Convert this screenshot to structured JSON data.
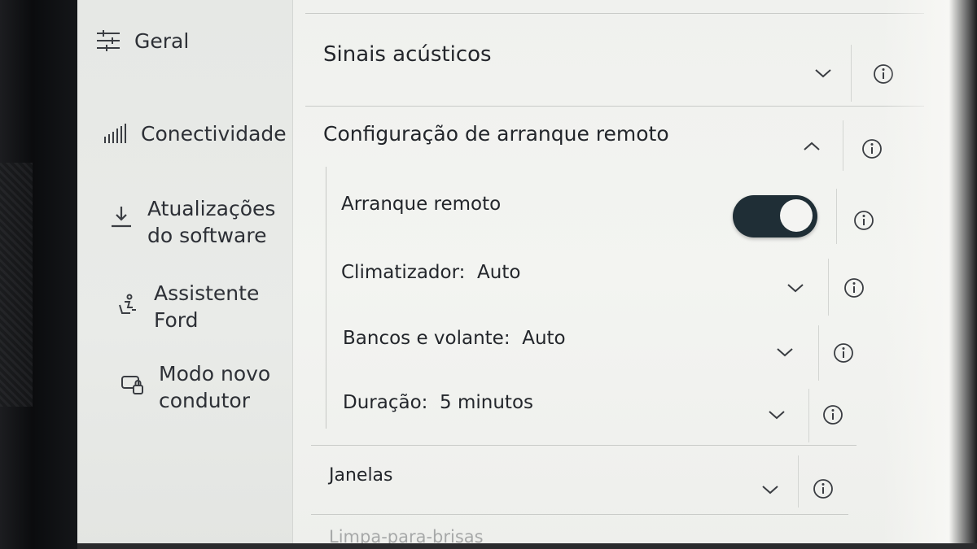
{
  "sidebar": {
    "items": [
      {
        "icon": "sliders-icon",
        "line1": "Geral",
        "line2": ""
      },
      {
        "icon": "signal-icon",
        "line1": "Conectividade",
        "line2": ""
      },
      {
        "icon": "download-icon",
        "line1": "Atualizações",
        "line2": "do software"
      },
      {
        "icon": "person-seat-icon",
        "line1": "Assistente",
        "line2": "Ford"
      },
      {
        "icon": "car-lock-icon",
        "line1": "Modo novo",
        "line2": "condutor"
      }
    ]
  },
  "sections": {
    "sinais": {
      "label": "Sinais acústicos",
      "expanded": false
    },
    "arranque": {
      "label": "Configuração de arranque remoto",
      "expanded": true,
      "settings": {
        "remote_start": {
          "label": "Arranque remoto",
          "enabled": true
        },
        "climate": {
          "label": "Climatizador:",
          "value": "Auto"
        },
        "seats": {
          "label": "Bancos e volante:",
          "value": "Auto"
        },
        "duration": {
          "label": "Duração:",
          "value": "5 minutos"
        }
      }
    },
    "janelas": {
      "label": "Janelas",
      "expanded": false
    },
    "limpa": {
      "label": "Limpa-para-brisas",
      "expanded": false
    }
  },
  "colors": {
    "toggle_on": "#1f2e36",
    "text": "#23262b",
    "panel": "#f1f2ef"
  }
}
